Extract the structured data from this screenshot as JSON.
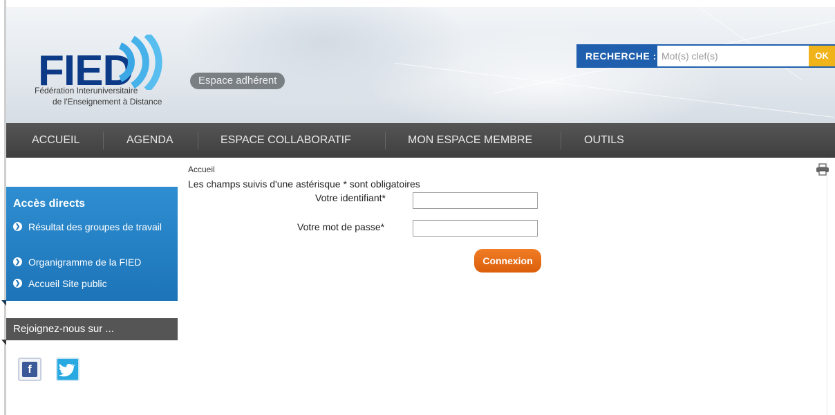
{
  "header": {
    "logo_text": "FIED",
    "logo_subtitle_line1": "Fédération Interuniversitaire",
    "logo_subtitle_line2": "de l'Enseignement à Distance",
    "badge": "Espace adhérent"
  },
  "search": {
    "label": "RECHERCHE :",
    "placeholder": "Mot(s) clef(s)",
    "button": "OK"
  },
  "nav": {
    "items": [
      "ACCUEIL",
      "AGENDA",
      "ESPACE COLLABORATIF",
      "MON ESPACE MEMBRE",
      "OUTILS"
    ]
  },
  "breadcrumb": "Accueil",
  "form": {
    "required_note": "Les champs suivis d'une astérisque * sont obligatoires",
    "id_label": "Votre identifiant*",
    "id_value": "",
    "password_label": "Votre mot de passe*",
    "password_value": "",
    "submit": "Connexion"
  },
  "sidebar": {
    "title": "Accès directs",
    "items": [
      "Résultat des groupes de travail",
      "Organigramme de la FIED",
      "Accueil Site public"
    ],
    "join_title": "Rejoignez-nous sur ...",
    "social": {
      "facebook_letter": "f"
    }
  },
  "colors": {
    "brand_blue": "#0c3a86",
    "search_blue": "#1f5fae",
    "ok_yellow": "#f0b31a",
    "nav_dark": "#4a4a4a",
    "sidebar_blue": "#2280c5",
    "connexion_orange": "#e8690f"
  },
  "icons": [
    "print-icon",
    "bullet-arrow-icon",
    "facebook-icon",
    "twitter-icon",
    "logo-waves-icon"
  ]
}
